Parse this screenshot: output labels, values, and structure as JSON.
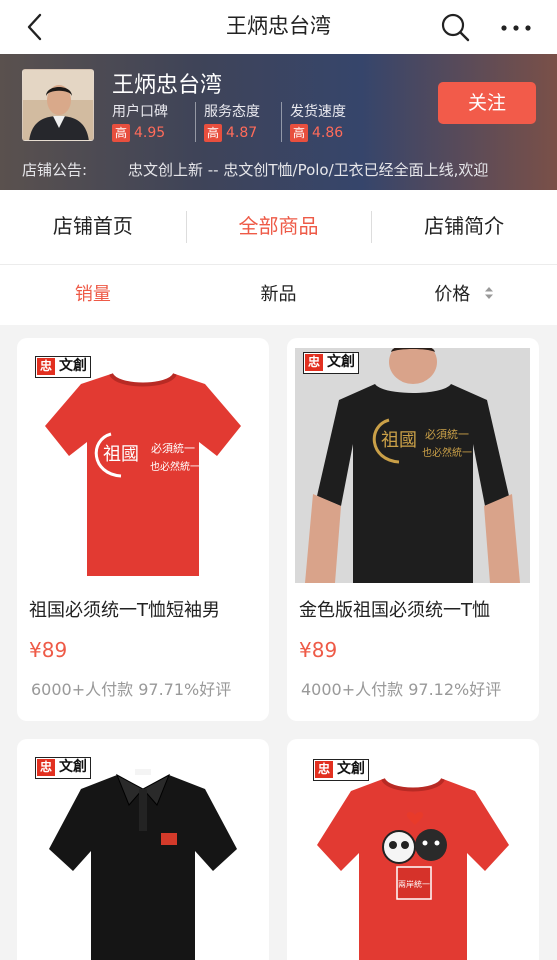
{
  "nav": {
    "title": "王炳忠台湾",
    "back_icon": "chevron-left-icon",
    "search_icon": "search-icon",
    "more_icon": "more-dots-icon"
  },
  "shop": {
    "name": "王炳忠台湾",
    "follow_label": "关注",
    "metrics": [
      {
        "label": "用户口碑",
        "badge": "高",
        "value": "4.95"
      },
      {
        "label": "服务态度",
        "badge": "高",
        "value": "4.87"
      },
      {
        "label": "发货速度",
        "badge": "高",
        "value": "4.86"
      }
    ],
    "notice_label": "店铺公告:",
    "notice_text": "忠文创上新 -- 忠文创T恤/Polo/卫衣已经全面上线,欢迎"
  },
  "tabs": [
    {
      "label": "店铺首页",
      "active": false
    },
    {
      "label": "全部商品",
      "active": true
    },
    {
      "label": "店铺简介",
      "active": false
    }
  ],
  "sort": [
    {
      "label": "销量",
      "active": true
    },
    {
      "label": "新品",
      "active": false
    },
    {
      "label": "价格",
      "active": false
    }
  ],
  "products": [
    {
      "title": "祖国必须统一T恤短袖男",
      "price": "¥89",
      "stats": "6000+人付款 97.71%好评",
      "shirt_color": "#e23a32"
    },
    {
      "title": "金色版祖国必须统一T恤",
      "price": "¥89",
      "stats": "4000+人付款 97.12%好评",
      "shirt_color": "#1e1e1e"
    },
    {
      "title": "",
      "price": "",
      "stats": "",
      "shirt_color": "#151515"
    },
    {
      "title": "",
      "price": "",
      "stats": "",
      "shirt_color": "#e23a32"
    }
  ],
  "brand_logo": {
    "red_part": "忠",
    "black_part": "文創"
  },
  "print_text": {
    "big": "祖國",
    "line1": "必須統一",
    "line2": "也必然統一",
    "bear_tag": "兩岸統一"
  },
  "colors": {
    "accent": "#ee5a47",
    "follow_button": "#f25b4a",
    "badge": "#e84f3e"
  }
}
